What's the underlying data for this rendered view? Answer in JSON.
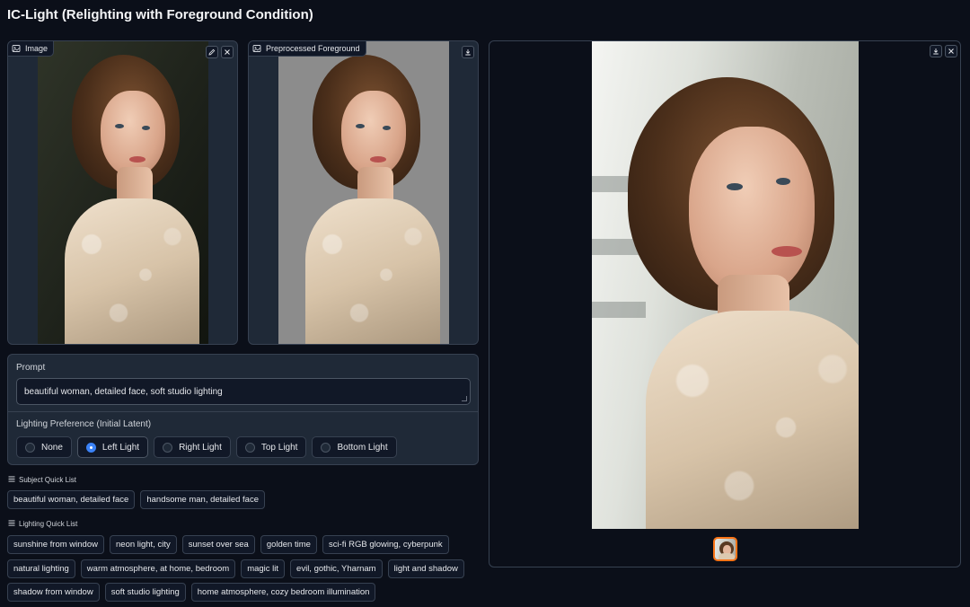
{
  "app": {
    "title": "IC-Light (Relighting with Foreground Condition)"
  },
  "input_image": {
    "label": "Image",
    "icon": "image-icon",
    "edit_icon": "pencil-icon",
    "clear_icon": "close-icon"
  },
  "preprocessed": {
    "label": "Preprocessed Foreground",
    "icon": "image-icon",
    "download_icon": "download-icon"
  },
  "output": {
    "download_icon": "download-icon",
    "close_icon": "close-icon"
  },
  "prompt": {
    "label": "Prompt",
    "value": "beautiful woman, detailed face, soft studio lighting"
  },
  "lighting": {
    "label": "Lighting Preference (Initial Latent)",
    "options": [
      "None",
      "Left Light",
      "Right Light",
      "Top Light",
      "Bottom Light"
    ],
    "selected": "Left Light",
    "accent": "#3b82f6"
  },
  "subject_quick_list": {
    "label": "Subject Quick List",
    "items": [
      "beautiful woman, detailed face",
      "handsome man, detailed face"
    ]
  },
  "lighting_quick_list": {
    "label": "Lighting Quick List",
    "rows": [
      [
        "sunshine from window",
        "neon light, city",
        "sunset over sea",
        "golden time",
        "sci-fi RGB glowing, cyberpunk"
      ],
      [
        "natural lighting",
        "warm atmosphere, at home, bedroom",
        "magic lit",
        "evil, gothic, Yharnam",
        "light and shadow"
      ],
      [
        "shadow from window",
        "soft studio lighting",
        "home atmosphere, cozy bedroom illumination"
      ]
    ]
  },
  "colors": {
    "background": "#0b0f19",
    "panel": "#1f2937",
    "thumbnail_border": "#f97316"
  }
}
